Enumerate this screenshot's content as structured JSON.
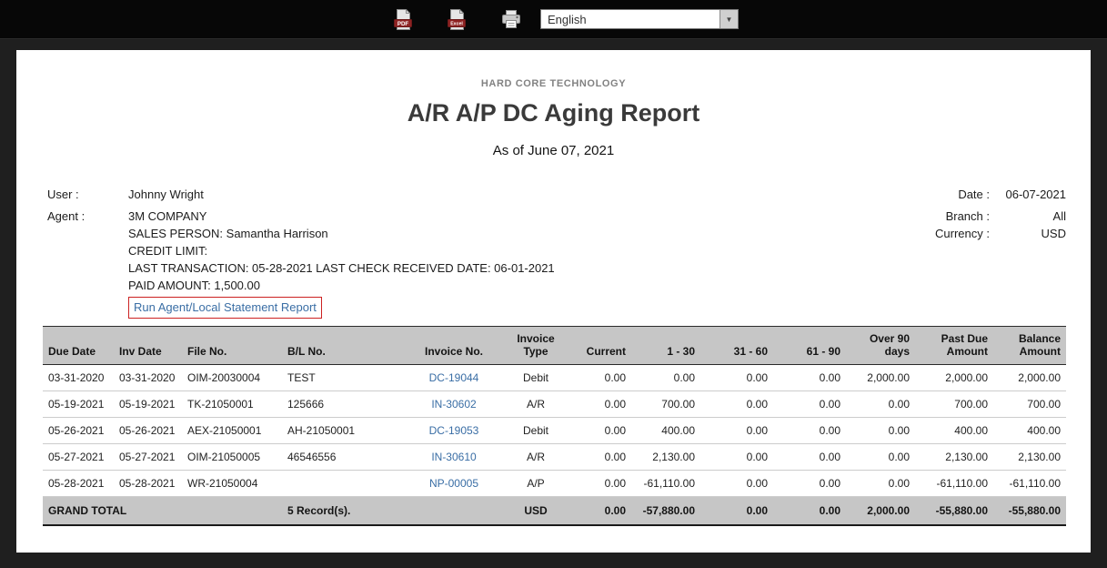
{
  "toolbar": {
    "pdf_label": "PDF",
    "excel_label": "Excel",
    "language": "English"
  },
  "report": {
    "company": "HARD CORE TECHNOLOGY",
    "title": "A/R A/P DC Aging Report",
    "as_of": "As of June 07, 2021"
  },
  "info": {
    "user_label": "User :",
    "user_value": "Johnny Wright",
    "agent_label": "Agent :",
    "agent_value": "3M COMPANY",
    "sales_person": "SALES PERSON: Samantha Harrison",
    "credit_limit": "CREDIT LIMIT:",
    "last_transaction": "LAST TRANSACTION: 05-28-2021 LAST CHECK RECEIVED DATE: 06-01-2021",
    "paid_amount": "PAID AMOUNT: 1,500.00",
    "statement_link": "Run Agent/Local Statement Report",
    "date_label": "Date :",
    "date_value": "06-07-2021",
    "branch_label": "Branch :",
    "branch_value": "All",
    "currency_label": "Currency :",
    "currency_value": "USD"
  },
  "colors": {
    "link_blue": "#3a6ea5",
    "highlight_red": "#cc2222",
    "table_header_bg": "#c6c6c6"
  },
  "table": {
    "headers": [
      "Due Date",
      "Inv Date",
      "File No.",
      "B/L No.",
      "Invoice No.",
      "Invoice Type",
      "Current",
      "1 - 30",
      "31 - 60",
      "61 - 90",
      "Over 90 days",
      "Past Due Amount",
      "Balance Amount"
    ],
    "col_aligns": [
      "l",
      "l",
      "l",
      "l",
      "c",
      "c",
      "r",
      "r",
      "r",
      "r",
      "r",
      "r",
      "r"
    ],
    "rows": [
      [
        "03-31-2020",
        "03-31-2020",
        "OIM-20030004",
        "TEST",
        "DC-19044",
        "Debit",
        "0.00",
        "0.00",
        "0.00",
        "0.00",
        "2,000.00",
        "2,000.00",
        "2,000.00"
      ],
      [
        "05-19-2021",
        "05-19-2021",
        "TK-21050001",
        "125666",
        "IN-30602",
        "A/R",
        "0.00",
        "700.00",
        "0.00",
        "0.00",
        "0.00",
        "700.00",
        "700.00"
      ],
      [
        "05-26-2021",
        "05-26-2021",
        "AEX-21050001",
        "AH-21050001",
        "DC-19053",
        "Debit",
        "0.00",
        "400.00",
        "0.00",
        "0.00",
        "0.00",
        "400.00",
        "400.00"
      ],
      [
        "05-27-2021",
        "05-27-2021",
        "OIM-21050005",
        "46546556",
        "IN-30610",
        "A/R",
        "0.00",
        "2,130.00",
        "0.00",
        "0.00",
        "0.00",
        "2,130.00",
        "2,130.00"
      ],
      [
        "05-28-2021",
        "05-28-2021",
        "WR-21050004",
        "",
        "NP-00005",
        "A/P",
        "0.00",
        "-61,110.00",
        "0.00",
        "0.00",
        "0.00",
        "-61,110.00",
        "-61,110.00"
      ]
    ],
    "grand_total": {
      "label": "GRAND TOTAL",
      "records": "5 Record(s).",
      "currency": "USD",
      "current": "0.00",
      "d1_30": "-57,880.00",
      "d31_60": "0.00",
      "d61_90": "0.00",
      "over_90": "2,000.00",
      "past_due": "-55,880.00",
      "balance": "-55,880.00"
    }
  }
}
